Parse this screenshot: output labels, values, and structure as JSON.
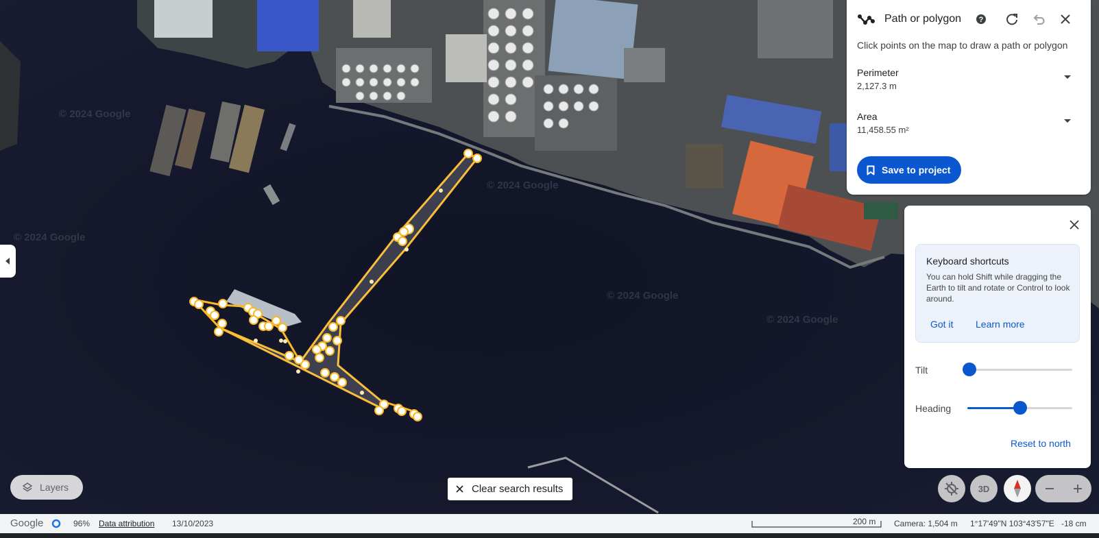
{
  "map": {
    "watermark": "© 2024 Google"
  },
  "measure_panel": {
    "title": "Path or polygon",
    "hint": "Click points on the map to draw a path or polygon",
    "perimeter_label": "Perimeter",
    "perimeter_value": "2,127.3 m",
    "area_label": "Area",
    "area_value": "11,458.55 m²",
    "save_label": "Save to project",
    "icons": [
      "path-icon",
      "help-icon",
      "refresh-icon",
      "undo-icon",
      "close-icon"
    ]
  },
  "view_panel": {
    "shortcuts_title": "Keyboard shortcuts",
    "shortcuts_text": "You can hold Shift while dragging the Earth to tilt and rotate or Control to look around.",
    "got_it": "Got it",
    "learn_more": "Learn more",
    "tilt_label": "Tilt",
    "tilt_value": 0.02,
    "heading_label": "Heading",
    "heading_value": 0.5,
    "reset_label": "Reset to north"
  },
  "controls": {
    "layers_label": "Layers",
    "clear_label": "Clear search results",
    "view_3d_label": "3D"
  },
  "status_bar": {
    "logo": "Google",
    "load_percent": "96%",
    "attribution": "Data attribution",
    "date": "13/10/2023",
    "scale": "200 m",
    "camera": "Camera: 1,504 m",
    "coords": "1°17'49\"N 103°43'57\"E",
    "elevation": "-18 cm"
  },
  "colors": {
    "accent": "#0b57d0",
    "path": "#f9b927",
    "water": "#10132a"
  }
}
